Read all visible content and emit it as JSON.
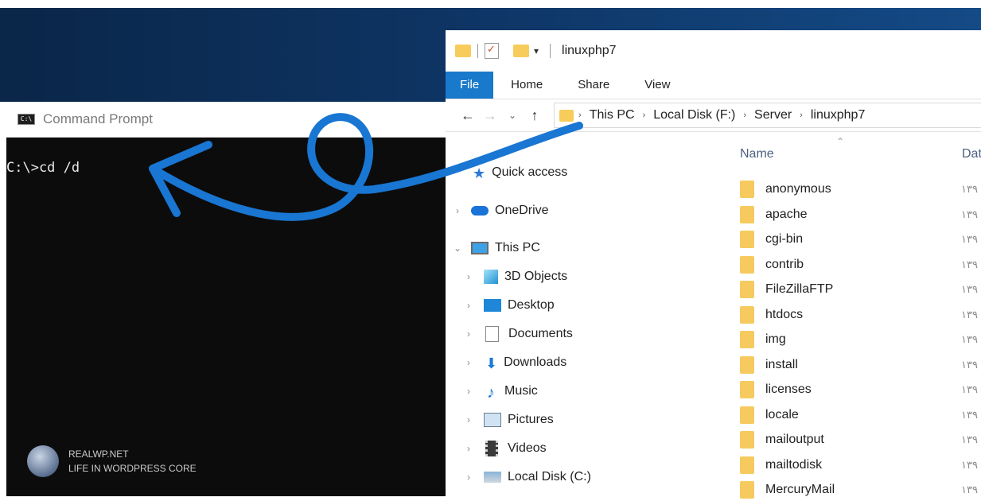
{
  "cmd": {
    "title": "Command Prompt",
    "icon_text": "C:\\",
    "line": "C:\\>cd /d"
  },
  "watermark": {
    "line1": "REALWP.NET",
    "line2": "LIFE IN WORDPRESS CORE"
  },
  "explorer": {
    "title": "linuxphp7",
    "ribbon_tabs": [
      "File",
      "Home",
      "Share",
      "View"
    ],
    "breadcrumbs": [
      "This PC",
      "Local Disk (F:)",
      "Server",
      "linuxphp7"
    ],
    "columns": {
      "name": "Name",
      "date": "Dat"
    },
    "nav": [
      {
        "label": "Quick access",
        "icon": "star-icon"
      },
      {
        "label": "OneDrive",
        "icon": "cloud-icon"
      },
      {
        "label": "This PC",
        "icon": "computer-icon"
      },
      {
        "label": "3D Objects",
        "icon": "cube-icon"
      },
      {
        "label": "Desktop",
        "icon": "desktop-icon"
      },
      {
        "label": "Documents",
        "icon": "document-icon"
      },
      {
        "label": "Downloads",
        "icon": "download-icon"
      },
      {
        "label": "Music",
        "icon": "music-icon"
      },
      {
        "label": "Pictures",
        "icon": "pictures-icon"
      },
      {
        "label": "Videos",
        "icon": "videos-icon"
      },
      {
        "label": "Local Disk (C:)",
        "icon": "disk-icon"
      }
    ],
    "files": [
      {
        "name": "anonymous",
        "date": "۱۳۹"
      },
      {
        "name": "apache",
        "date": "۱۳۹"
      },
      {
        "name": "cgi-bin",
        "date": "۱۳۹"
      },
      {
        "name": "contrib",
        "date": "۱۳۹"
      },
      {
        "name": "FileZillaFTP",
        "date": "۱۳۹"
      },
      {
        "name": "htdocs",
        "date": "۱۳۹"
      },
      {
        "name": "img",
        "date": "۱۳۹"
      },
      {
        "name": "install",
        "date": "۱۳۹"
      },
      {
        "name": "licenses",
        "date": "۱۳۹"
      },
      {
        "name": "locale",
        "date": "۱۳۹"
      },
      {
        "name": "mailoutput",
        "date": "۱۳۹"
      },
      {
        "name": "mailtodisk",
        "date": "۱۳۹"
      },
      {
        "name": "MercuryMail",
        "date": "۱۳۹"
      }
    ]
  },
  "colors": {
    "file_tab": "#1979ca",
    "arrow": "#1976d2",
    "folder": "#f6ca5e"
  }
}
